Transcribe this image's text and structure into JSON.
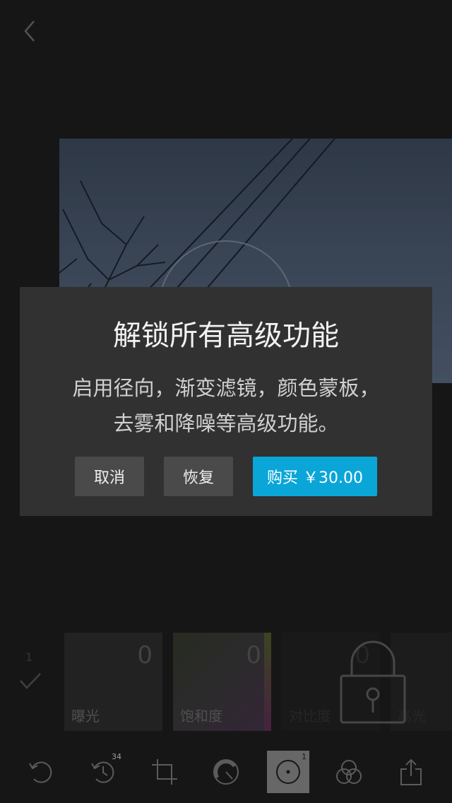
{
  "dialog": {
    "title": "解锁所有高级功能",
    "message_line1": "启用径向，渐变滤镜，颜色蒙板，",
    "message_line2": "去雾和降噪等高级功能。",
    "cancel_label": "取消",
    "restore_label": "恢复",
    "buy_label": "购买 ￥30.00"
  },
  "adjust": {
    "count": "1",
    "tiles": [
      {
        "label": "曝光",
        "value": "0"
      },
      {
        "label": "饱和度",
        "value": "0"
      },
      {
        "label": "对比度",
        "value": "0"
      },
      {
        "label": "高光",
        "value": ""
      }
    ]
  },
  "toolbar": {
    "history_badge": "34",
    "radial_badge": "1"
  },
  "colors": {
    "accent": "#0aa6d8",
    "background": "#1e1e1e",
    "dialog": "#313131"
  }
}
